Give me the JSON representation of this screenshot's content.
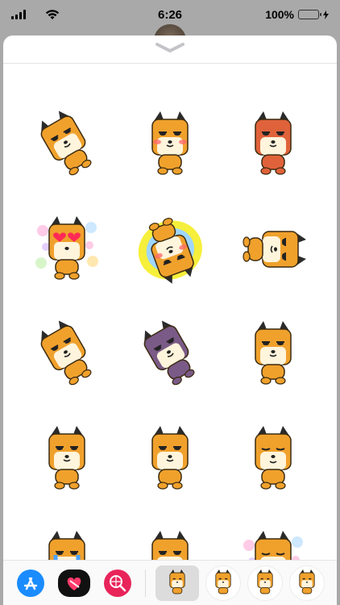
{
  "status": {
    "time": "6:26",
    "battery_text": "100%",
    "battery_level": 1.0
  },
  "sheet": {
    "collapse_icon": "chevron-down-icon"
  },
  "stickers": [
    {
      "name": "sticker-dog-lying-lean",
      "bg": "none",
      "body": "#f0a12c"
    },
    {
      "name": "sticker-dog-blush",
      "bg": "none",
      "body": "#f0a12c"
    },
    {
      "name": "sticker-dog-angry-red",
      "bg": "none",
      "body": "#e0623a"
    },
    {
      "name": "sticker-dog-hearts",
      "bg": "flowers",
      "body": "#f0a12c"
    },
    {
      "name": "sticker-dog-dizzy-spiral",
      "bg": "swirl",
      "body": "#f0a12c"
    },
    {
      "name": "sticker-dog-peek",
      "bg": "none",
      "body": "#f0a12c"
    },
    {
      "name": "sticker-dog-sweat-run",
      "bg": "none",
      "body": "#f0a12c"
    },
    {
      "name": "sticker-dog-gloomy-purple",
      "bg": "none",
      "body": "#7a5a86"
    },
    {
      "name": "sticker-dog-thinking",
      "bg": "none",
      "body": "#f0a12c"
    },
    {
      "name": "sticker-dog-ok-hand",
      "bg": "none",
      "body": "#f0a12c"
    },
    {
      "name": "sticker-dog-standing",
      "bg": "none",
      "body": "#f0a12c"
    },
    {
      "name": "sticker-dog-smile",
      "bg": "none",
      "body": "#f0a12c"
    },
    {
      "name": "sticker-dog-crying",
      "bg": "none",
      "body": "#f0a12c"
    },
    {
      "name": "sticker-dog-coffee",
      "bg": "none",
      "body": "#f0a12c"
    },
    {
      "name": "sticker-dog-flowers",
      "bg": "flowers",
      "body": "#f0a12c"
    }
  ],
  "dock": {
    "apps": [
      {
        "name": "app-store-button",
        "icon": "app-store-icon",
        "color": "#1a8cff"
      },
      {
        "name": "digital-touch-button",
        "icon": "heart-touch-icon",
        "color": "#111111"
      },
      {
        "name": "web-images-button",
        "icon": "globe-search-icon",
        "color": "#e8245a"
      }
    ],
    "sticker_packs": [
      {
        "name": "sticker-pack-tsuntsun-selected",
        "selected": true
      },
      {
        "name": "sticker-pack-2",
        "selected": false
      },
      {
        "name": "sticker-pack-3",
        "selected": false
      },
      {
        "name": "sticker-pack-4",
        "selected": false
      }
    ]
  }
}
